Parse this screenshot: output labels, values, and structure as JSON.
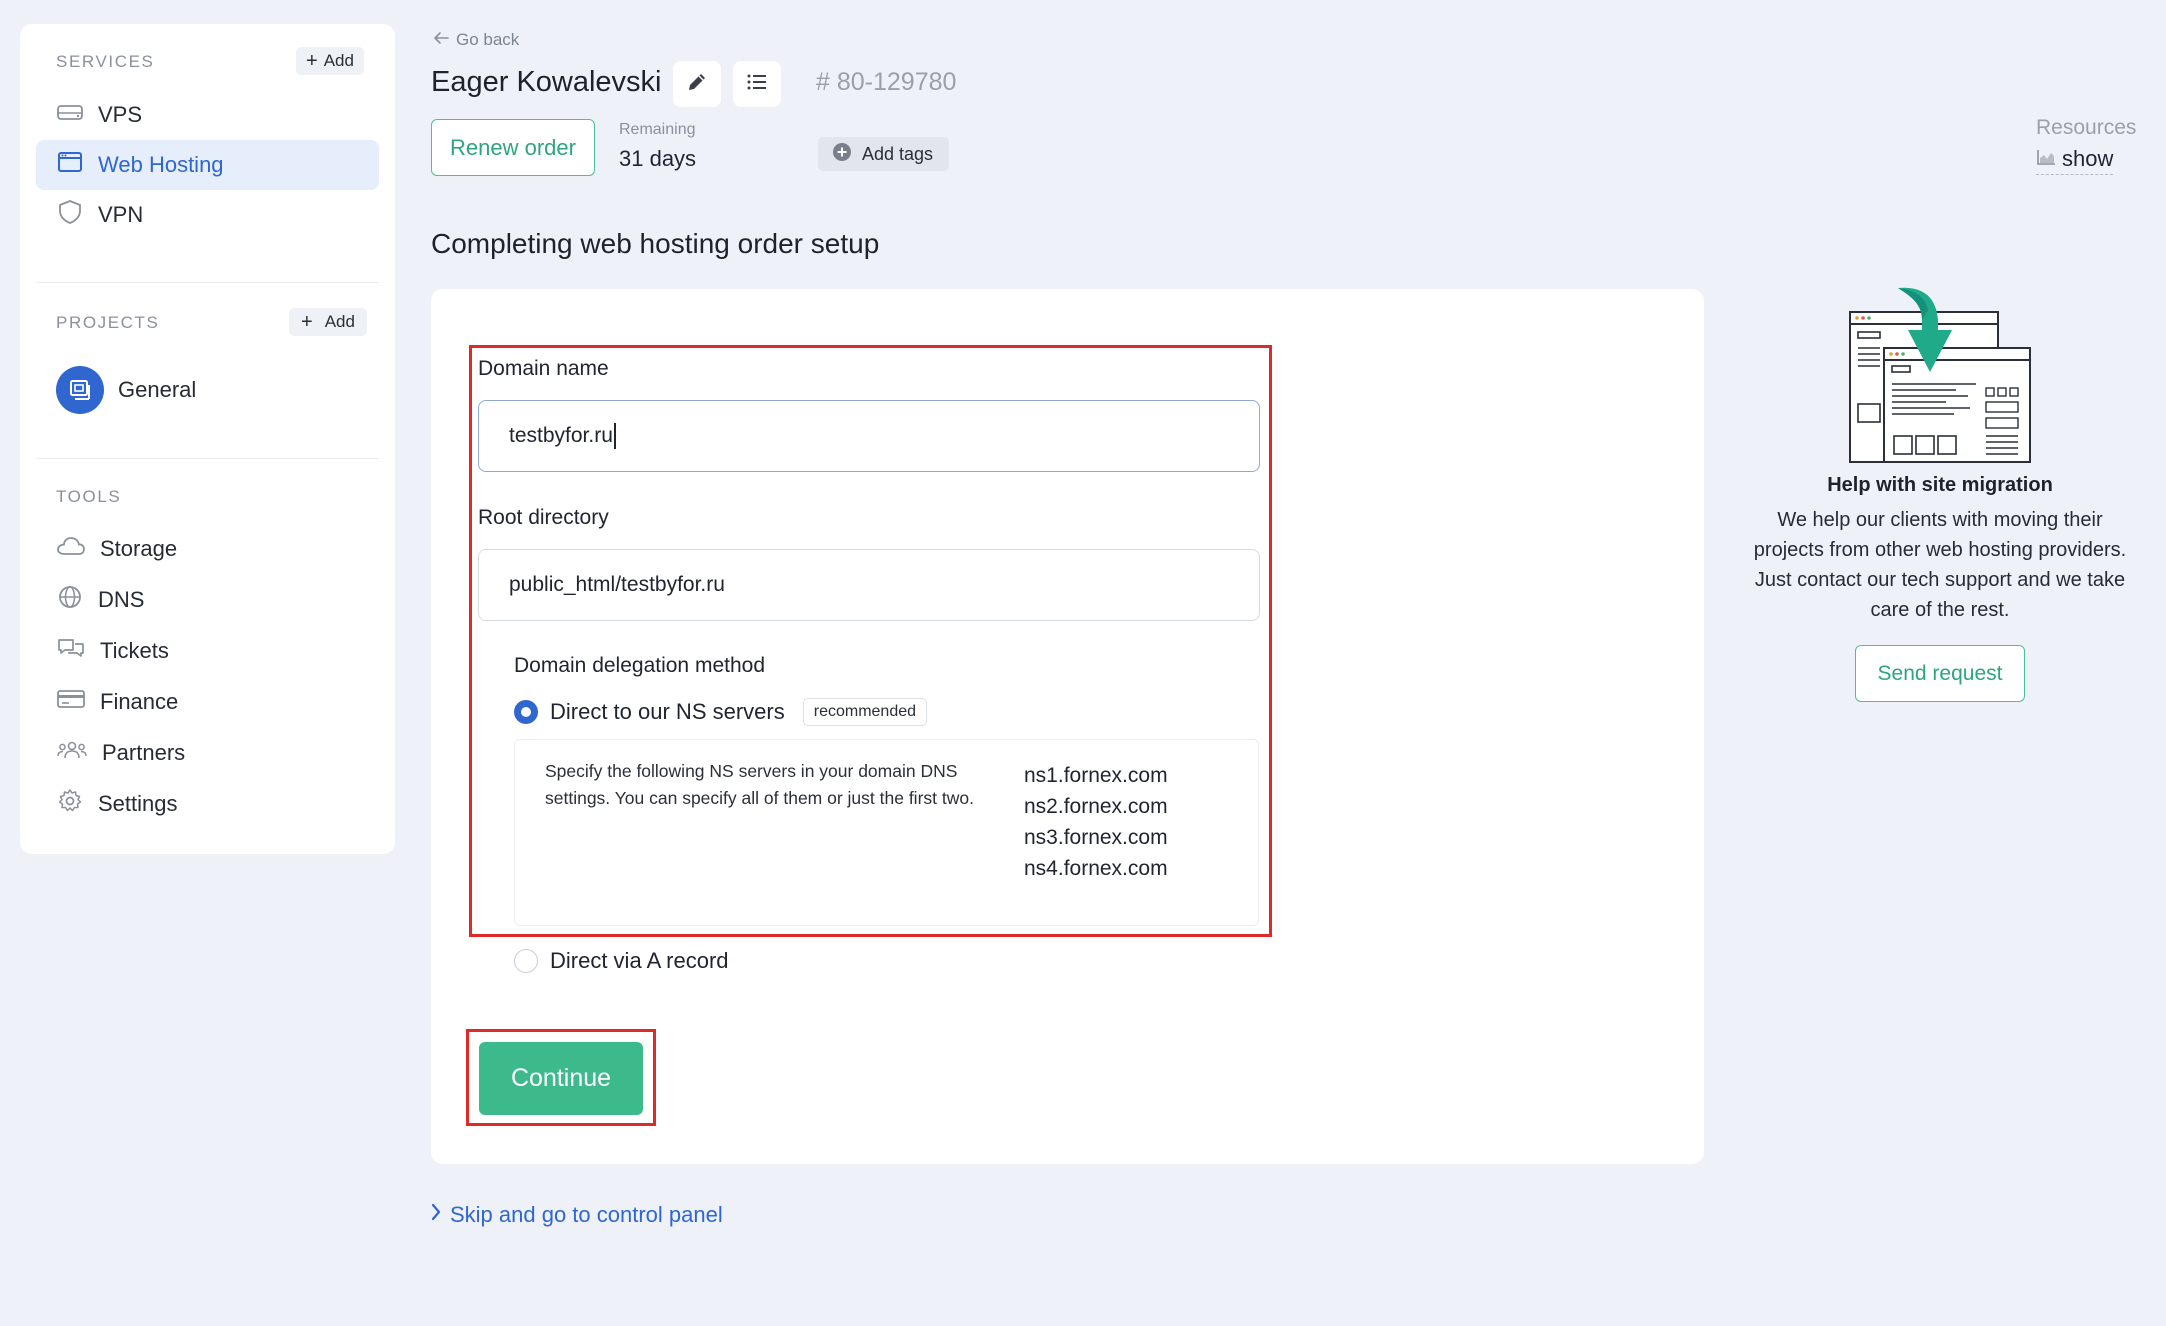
{
  "sidebar": {
    "services_heading": "SERVICES",
    "services_add": "Add",
    "services": [
      {
        "label": "VPS",
        "icon": "server-icon"
      },
      {
        "label": "Web Hosting",
        "icon": "browser-window-icon",
        "active": true
      },
      {
        "label": "VPN",
        "icon": "shield-icon"
      }
    ],
    "projects_heading": "PROJECTS",
    "projects_add": "Add",
    "projects": [
      {
        "label": "General",
        "icon": "project-icon"
      }
    ],
    "tools_heading": "TOOLS",
    "tools": [
      {
        "label": "Storage",
        "icon": "cloud-icon"
      },
      {
        "label": "DNS",
        "icon": "globe-icon"
      },
      {
        "label": "Tickets",
        "icon": "chat-bubbles-icon"
      },
      {
        "label": "Finance",
        "icon": "credit-card-icon"
      },
      {
        "label": "Partners",
        "icon": "people-icon"
      },
      {
        "label": "Settings",
        "icon": "gear-icon"
      }
    ]
  },
  "header": {
    "go_back": "Go back",
    "title": "Eager Kowalevski",
    "order_id": "# 80-129780",
    "renew_label": "Renew order",
    "remaining_label": "Remaining",
    "remaining_value": "31 days",
    "add_tags_label": "Add tags",
    "resources_label": "Resources",
    "resources_show": "show"
  },
  "main": {
    "section_title": "Completing web hosting order setup",
    "domain_label": "Domain name",
    "domain_value": "testbyfor.ru",
    "root_label": "Root directory",
    "root_value": "public_html/testbyfor.ru",
    "delegation_label": "Domain delegation method",
    "option_ns_label": "Direct to our NS servers",
    "option_ns_badge": "recommended",
    "ns_description": "Specify the following NS servers in your domain DNS settings. You can specify all of them or just the first two.",
    "ns_servers": [
      "ns1.fornex.com",
      "ns2.fornex.com",
      "ns3.fornex.com",
      "ns4.fornex.com"
    ],
    "option_a_label": "Direct via A record",
    "continue_label": "Continue",
    "skip_label": "Skip and go to control panel"
  },
  "migration": {
    "title": "Help with site migration",
    "text": "We help our clients with moving their projects from other web hosting providers. Just contact our tech support and we take care of the rest.",
    "button": "Send request"
  },
  "colors": {
    "accent_blue": "#2f66cf",
    "accent_green": "#3dba8c",
    "highlight_red": "#e02a2a",
    "page_bg": "#eef2f8"
  }
}
